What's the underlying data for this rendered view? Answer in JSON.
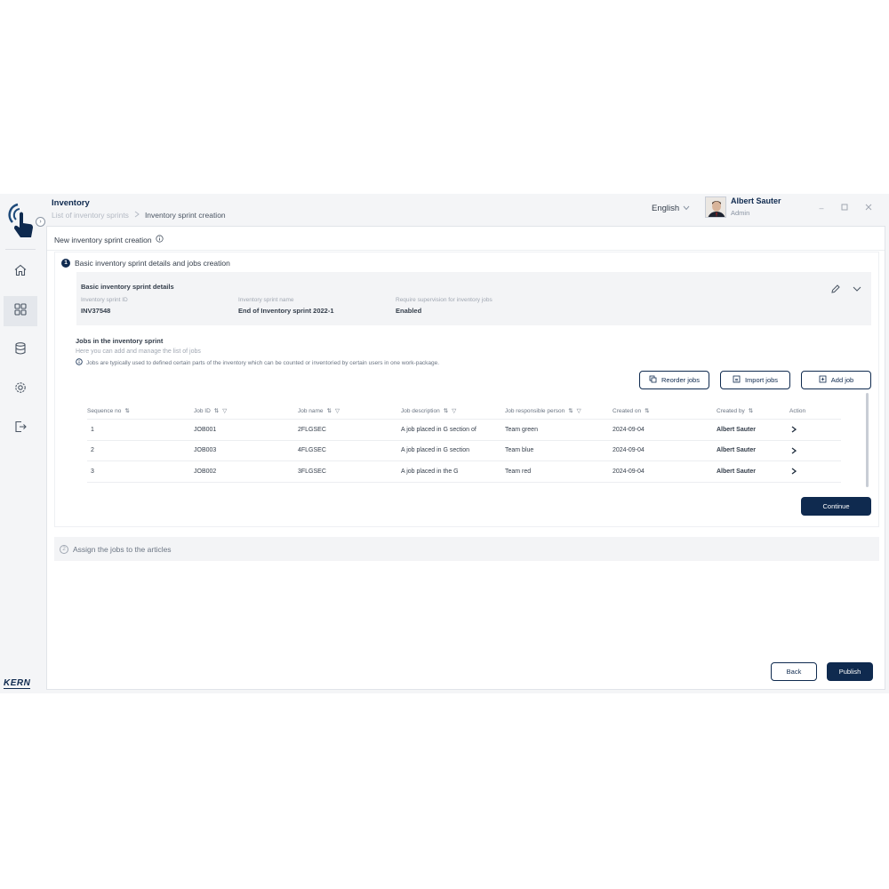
{
  "header": {
    "app_title": "Inventory",
    "breadcrumb": [
      "List of inventory sprints",
      "Inventory sprint creation"
    ],
    "language": "English",
    "user_name": "Albert Sauter",
    "user_role": "Admin",
    "window_controls": [
      "minimize-icon",
      "maximize-icon",
      "close-icon"
    ]
  },
  "sidebar": {
    "items": [
      "home-icon",
      "dashboard-icon",
      "database-icon",
      "settings-icon",
      "logout-icon"
    ],
    "active": "dashboard-icon",
    "brand": "KERN"
  },
  "page": {
    "title": "New inventory sprint creation"
  },
  "step1": {
    "number": "1",
    "title": "Basic inventory sprint details and jobs creation",
    "details": {
      "title": "Basic inventory sprint details",
      "fields": [
        {
          "label": "Inventory sprint ID",
          "value": "INV37548"
        },
        {
          "label": "Inventory sprint name",
          "value": "End of Inventory sprint 2022-1"
        },
        {
          "label": "Require supervision for inventory jobs",
          "value": "Enabled"
        }
      ]
    },
    "jobs": {
      "title": "Jobs in the inventory sprint",
      "subtitle": "Here you can add and manage the list of jobs",
      "info": "Jobs are typically used to defined certain parts of the inventory which can be counted or inventoried by certain users in one work-package.",
      "buttons": {
        "reorder": "Reorder jobs",
        "import": "Import jobs",
        "add": "Add job"
      },
      "columns": [
        "Sequence no",
        "Job ID",
        "Job name",
        "Job description",
        "Job responsible person",
        "Created on",
        "Created by",
        "Action"
      ],
      "rows": [
        {
          "seq": "1",
          "id": "JOB001",
          "name": "2FLGSEC",
          "desc": "A job placed in G section of",
          "person": "Team green",
          "created_on": "2024-09-04",
          "created_by": "Albert Sauter"
        },
        {
          "seq": "2",
          "id": "JOB003",
          "name": "4FLGSEC",
          "desc": "A job placed in G section",
          "person": "Team blue",
          "created_on": "2024-09-04",
          "created_by": "Albert Sauter"
        },
        {
          "seq": "3",
          "id": "JOB002",
          "name": "3FLGSEC",
          "desc": "A job placed in the G",
          "person": "Team red",
          "created_on": "2024-09-04",
          "created_by": "Albert Sauter"
        }
      ]
    },
    "continue_label": "Continue"
  },
  "step2": {
    "number": "2",
    "title": "Assign the jobs to the articles"
  },
  "footer": {
    "back_label": "Back",
    "publish_label": "Publish"
  },
  "colors": {
    "primary": "#0f2a4f",
    "background": "#f4f5f7"
  }
}
